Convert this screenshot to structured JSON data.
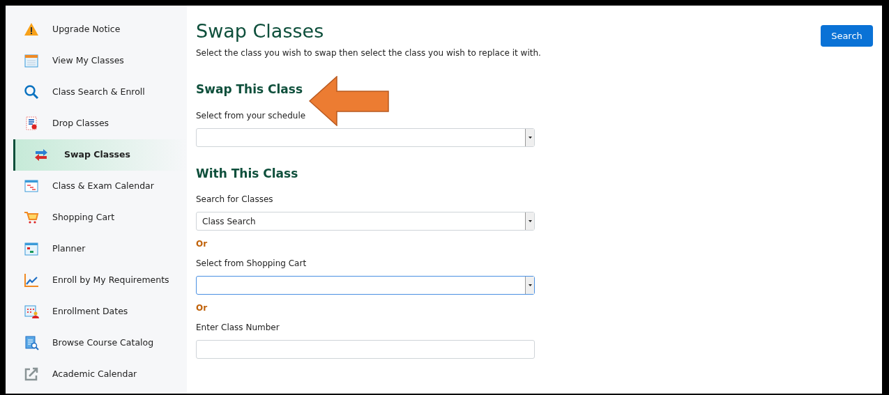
{
  "sidebar": {
    "items": [
      {
        "label": "Upgrade Notice",
        "selected": false
      },
      {
        "label": "View My Classes",
        "selected": false
      },
      {
        "label": "Class Search & Enroll",
        "selected": false
      },
      {
        "label": "Drop Classes",
        "selected": false
      },
      {
        "label": "Swap Classes",
        "selected": true
      },
      {
        "label": "Class & Exam Calendar",
        "selected": false
      },
      {
        "label": "Shopping Cart",
        "selected": false
      },
      {
        "label": "Planner",
        "selected": false
      },
      {
        "label": "Enroll by My Requirements",
        "selected": false
      },
      {
        "label": "Enrollment Dates",
        "selected": false
      },
      {
        "label": "Browse Course Catalog",
        "selected": false
      },
      {
        "label": "Academic Calendar",
        "selected": false
      }
    ]
  },
  "page": {
    "title": "Swap Classes",
    "search_button": "Search",
    "instructions": "Select the class you wish to swap then select the class you wish to replace it with."
  },
  "sections": [
    {
      "heading": "Swap This Class",
      "items": [
        {
          "kind": "label",
          "text": "Select from your schedule"
        },
        {
          "kind": "select",
          "focused": false
        }
      ]
    },
    {
      "heading": "With This Class",
      "items": [
        {
          "kind": "label",
          "text": "Search for Classes"
        },
        {
          "kind": "select",
          "value": "Class Search",
          "focused": false
        },
        {
          "kind": "or",
          "text": "Or"
        },
        {
          "kind": "label",
          "text": "Select from Shopping Cart"
        },
        {
          "kind": "select",
          "focused": true
        },
        {
          "kind": "or",
          "text": "Or"
        },
        {
          "kind": "label",
          "text": "Enter Class Number"
        },
        {
          "kind": "input",
          "focused": false
        }
      ]
    }
  ]
}
